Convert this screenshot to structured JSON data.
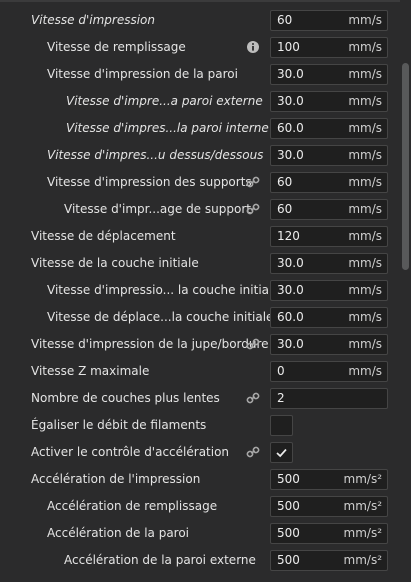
{
  "rows": [
    {
      "label": "Vitesse d'impression",
      "value": "60",
      "unit": "mm/s"
    },
    {
      "label": "Vitesse de remplissage",
      "value": "100",
      "unit": "mm/s",
      "icon": "info-icon"
    },
    {
      "label": "Vitesse d'impression de la paroi",
      "value": "30.0",
      "unit": "mm/s"
    },
    {
      "label": "Vitesse d'impre...a paroi externe",
      "value": "30.0",
      "unit": "mm/s"
    },
    {
      "label": "Vitesse d'impres...la paroi interne",
      "value": "60.0",
      "unit": "mm/s"
    },
    {
      "label": "Vitesse d'impres...u dessus/dessous",
      "value": "30.0",
      "unit": "mm/s"
    },
    {
      "label": "Vitesse d'impression des supports",
      "value": "60",
      "unit": "mm/s",
      "icon": "link-icon"
    },
    {
      "label": "Vitesse d'impr...age de support",
      "value": "60",
      "unit": "mm/s",
      "icon": "link-icon"
    },
    {
      "label": "Vitesse de déplacement",
      "value": "120",
      "unit": "mm/s"
    },
    {
      "label": "Vitesse de la couche initiale",
      "value": "30.0",
      "unit": "mm/s"
    },
    {
      "label": "Vitesse d'impressio... la couche initiale",
      "value": "30.0",
      "unit": "mm/s"
    },
    {
      "label": "Vitesse de déplace...la couche initiale",
      "value": "60.0",
      "unit": "mm/s"
    },
    {
      "label": "Vitesse d'impression de la jupe/bordure",
      "value": "30.0",
      "unit": "mm/s",
      "icon": "link-icon"
    },
    {
      "label": "Vitesse Z maximale",
      "value": "0",
      "unit": "mm/s"
    },
    {
      "label": "Nombre de couches plus lentes",
      "value": "2",
      "unit": "",
      "icon": "link-icon"
    },
    {
      "label": "Égaliser le débit de filaments",
      "checked": false
    },
    {
      "label": "Activer le contrôle d'accélération",
      "checked": true,
      "icon": "link-icon"
    },
    {
      "label": "Accélération de l'impression",
      "value": "500",
      "unit": "mm/s²"
    },
    {
      "label": "Accélération de remplissage",
      "value": "500",
      "unit": "mm/s²"
    },
    {
      "label": "Accélération de la paroi",
      "value": "500",
      "unit": "mm/s²"
    },
    {
      "label": "Accélération de la paroi externe",
      "value": "500",
      "unit": "mm/s²"
    }
  ]
}
